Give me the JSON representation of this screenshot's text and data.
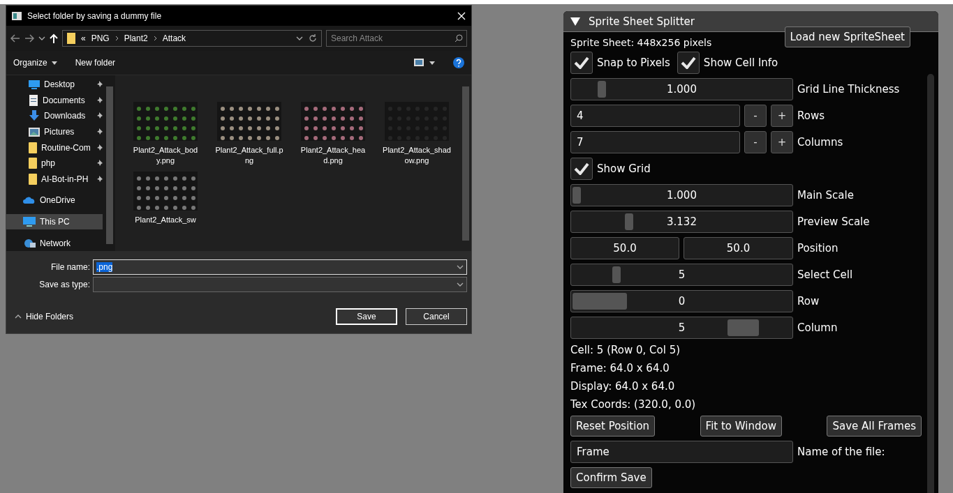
{
  "dialog": {
    "title": "Select folder by saving a dummy file",
    "breadcrumb_prefix": "«",
    "breadcrumb": [
      "PNG",
      "Plant2",
      "Attack"
    ],
    "search": {
      "placeholder": "Search Attack"
    },
    "toolbar": [
      "Organize",
      "New folder"
    ],
    "nav_items": [
      {
        "label": "Desktop",
        "pinned": true,
        "selected": false
      },
      {
        "label": "Documents",
        "pinned": true,
        "selected": false
      },
      {
        "label": "Downloads",
        "pinned": true,
        "selected": false
      },
      {
        "label": "Pictures",
        "pinned": true,
        "selected": false
      },
      {
        "label": "Routine-Com",
        "pinned": true,
        "selected": false
      },
      {
        "label": "php",
        "pinned": true,
        "selected": false
      },
      {
        "label": "AI-Bot-in-PH",
        "pinned": true,
        "selected": false
      },
      {
        "label": "OneDrive",
        "pinned": false,
        "selected": false
      },
      {
        "label": "This PC",
        "pinned": false,
        "selected": true
      },
      {
        "label": "Network",
        "pinned": false,
        "selected": false
      }
    ],
    "files": [
      {
        "name": "Plant2_Attack_body.png",
        "kind": "picture"
      },
      {
        "name": "Plant2_Attack_full.png",
        "kind": "picture"
      },
      {
        "name": "Plant2_Attack_head.png",
        "kind": "picture"
      },
      {
        "name": "Plant2_Attack_shadow.png",
        "kind": "picture"
      },
      {
        "name": "Plant2_Attack_sw",
        "kind": "picture"
      }
    ],
    "file_name_label": "File name:",
    "file_name_value": ".png",
    "save_type_label": "Save as type:",
    "hide_folders": "Hide Folders",
    "buttons": [
      "Save",
      "Cancel"
    ]
  },
  "panel": {
    "title": "Sprite Sheet Splitter",
    "expanded": true,
    "info": "Sprite Sheet: 448x256 pixels",
    "load_button": "Load new SpriteSheet",
    "rows": [
      {
        "kind": "checks",
        "items": [
          {
            "label": "Snap to Pixels",
            "checked": true
          },
          {
            "label": "Show Cell Info",
            "checked": true
          }
        ]
      },
      {
        "kind": "float_slider",
        "value": "1.000",
        "level": 0.12,
        "label": "Grid Line Thickness"
      },
      {
        "kind": "stepper",
        "value": "4",
        "minus": "-",
        "plus": "+",
        "label": "Rows"
      },
      {
        "kind": "stepper",
        "value": "7",
        "minus": "-",
        "plus": "+",
        "label": "Columns"
      },
      {
        "kind": "checks",
        "items": [
          {
            "label": "Show Grid",
            "checked": true
          }
        ]
      },
      {
        "kind": "float_slider",
        "value": "1.000",
        "level": 0.0,
        "label": "Main Scale"
      },
      {
        "kind": "float_slider",
        "value": "3.132",
        "level": 0.25,
        "label": "Preview Scale"
      },
      {
        "kind": "pair",
        "values": [
          "50.0",
          "50.0"
        ],
        "label": "Position"
      },
      {
        "kind": "float_slider",
        "value": "5",
        "level": 0.19,
        "label": "Select Cell"
      },
      {
        "kind": "int_slider",
        "value": "0",
        "level": 0.0,
        "label": "Row"
      },
      {
        "kind": "int_slider",
        "value": "5",
        "level": 0.83,
        "label": "Column"
      }
    ],
    "details": [
      "Cell: 5 (Row 0, Col 5)",
      "Frame: 64.0 x 64.0",
      "Display: 64.0 x 64.0",
      "Tex Coords: (320.0, 0.0)"
    ],
    "actions": [
      "Reset Position",
      "Fit to Window",
      "Save All Frames"
    ],
    "file_field": {
      "value": "Frame",
      "label": "Name of the file:"
    },
    "confirm_button": "Confirm Save"
  }
}
